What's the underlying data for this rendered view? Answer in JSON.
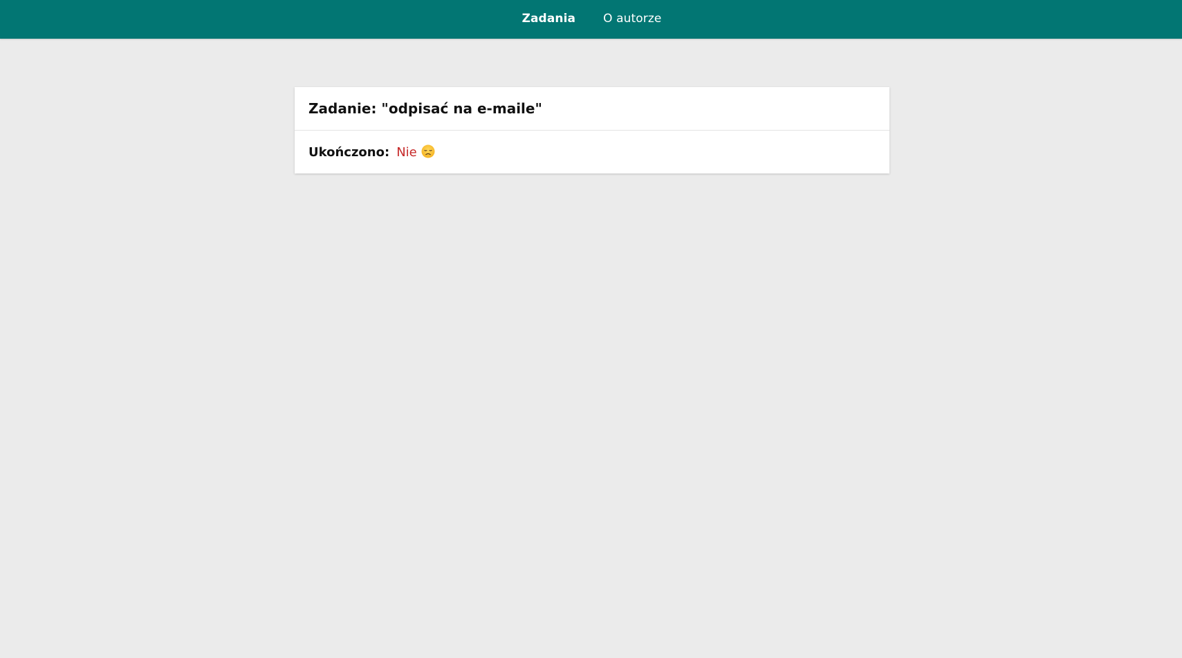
{
  "nav": {
    "items": [
      {
        "label": "Zadania",
        "active": true
      },
      {
        "label": "O autorze",
        "active": false
      }
    ],
    "background": "#027673"
  },
  "task": {
    "title": "Zadanie: \"odpisać na e-maile\"",
    "status_label": "Ukończono:",
    "status_value": "Nie",
    "status_color": "#c62828",
    "status_icon": "disappointed-face-icon"
  }
}
